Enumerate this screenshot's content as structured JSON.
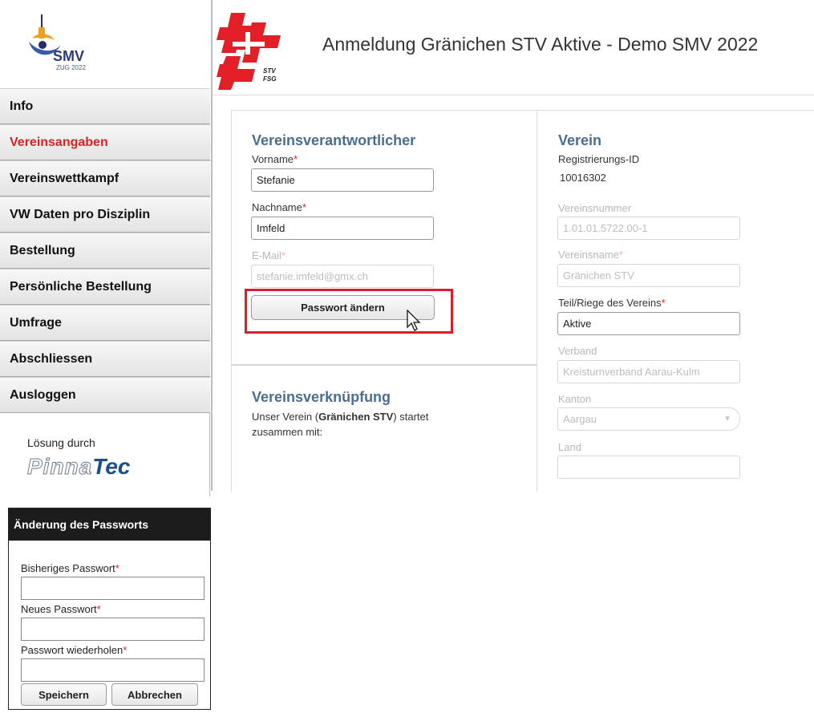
{
  "header": {
    "smv_logo_text": "SMV",
    "smv_logo_subtext": "ZUG 2022",
    "stv_logo_text": "STV",
    "stv_logo_subtext": "FSG",
    "title": "Anmeldung Gränichen STV Aktive - Demo SMV 2022"
  },
  "sidebar": {
    "items": [
      {
        "label": "Info",
        "active": false
      },
      {
        "label": "Vereinsangaben",
        "active": true
      },
      {
        "label": "Vereinswettkampf",
        "active": false
      },
      {
        "label": "VW Daten pro Disziplin",
        "active": false
      },
      {
        "label": "Bestellung",
        "active": false
      },
      {
        "label": "Persönliche Bestellung",
        "active": false
      },
      {
        "label": "Umfrage",
        "active": false
      },
      {
        "label": "Abschliessen",
        "active": false
      },
      {
        "label": "Ausloggen",
        "active": false
      }
    ],
    "solution_label": "Lösung durch",
    "vendor_part1": "Pinna",
    "vendor_part2": "Tec"
  },
  "contact": {
    "title": "Vereinsverantwortlicher",
    "firstname_label": "Vorname",
    "firstname_value": "Stefanie",
    "lastname_label": "Nachname",
    "lastname_value": "Imfeld",
    "email_label": "E-Mail",
    "email_value": "stefanie.imfeld@gmx.ch",
    "change_password_button": "Passwort ändern",
    "required_mark": "*"
  },
  "link": {
    "title": "Vereinsverknüpfung",
    "text_prefix": "Unser Verein (",
    "club_name": "Gränichen STV",
    "text_suffix": ") startet",
    "text_line2": "zusammen mit:"
  },
  "club": {
    "title": "Verein",
    "reg_id_label": "Registrierungs-ID",
    "reg_id_value": "10016302",
    "number_label": "Vereinsnummer",
    "number_value": "1.01.01.5722.00-1",
    "name_label": "Vereinsname",
    "name_value": "Gränichen STV",
    "section_label": "Teil/Riege des Vereins",
    "section_value": "Aktive",
    "association_label": "Verband",
    "association_value": "Kreisturnverband Aarau-Kulm",
    "canton_label": "Kanton",
    "canton_value": "Aargau",
    "country_label": "Land",
    "country_value": ""
  },
  "modal": {
    "title": "Änderung des Passworts",
    "old_password_label": "Bisheriges Passwort",
    "new_password_label": "Neues Passwort",
    "repeat_password_label": "Passwort wiederholen",
    "save_button": "Speichern",
    "cancel_button": "Abbrechen"
  },
  "colors": {
    "accent_red": "#e02020",
    "section_blue": "#4a6e92",
    "highlight_red": "#d9202a"
  }
}
